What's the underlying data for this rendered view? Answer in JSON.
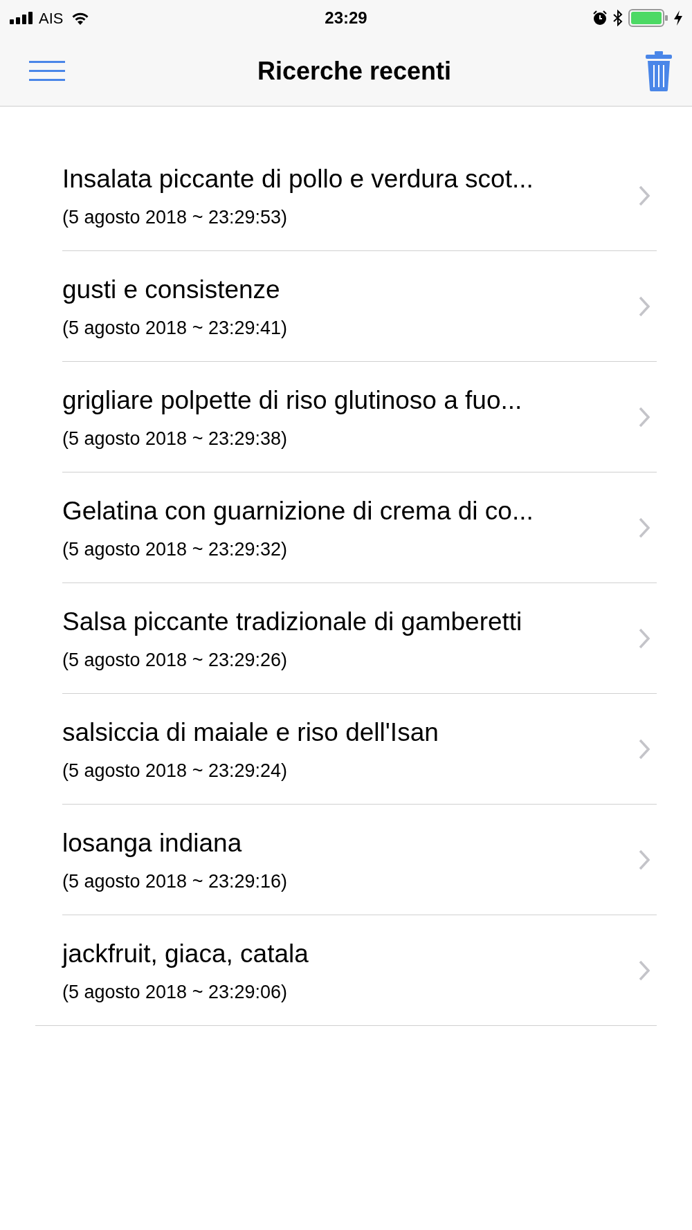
{
  "status_bar": {
    "carrier": "AIS",
    "time": "23:29"
  },
  "header": {
    "title": "Ricerche recenti"
  },
  "searches": [
    {
      "title": "Insalata piccante di pollo e verdura scot...",
      "timestamp": "(5 agosto 2018 ~ 23:29:53)"
    },
    {
      "title": "gusti e consistenze",
      "timestamp": "(5 agosto 2018 ~ 23:29:41)"
    },
    {
      "title": "grigliare polpette di riso glutinoso a fuo...",
      "timestamp": "(5 agosto 2018 ~ 23:29:38)"
    },
    {
      "title": "Gelatina con guarnizione di crema di co...",
      "timestamp": "(5 agosto 2018 ~ 23:29:32)"
    },
    {
      "title": "Salsa piccante tradizionale di gamberetti",
      "timestamp": "(5 agosto 2018 ~ 23:29:26)"
    },
    {
      "title": "salsiccia di maiale e riso dell'Isan",
      "timestamp": "(5 agosto 2018 ~ 23:29:24)"
    },
    {
      "title": "losanga indiana",
      "timestamp": "(5 agosto 2018 ~ 23:29:16)"
    },
    {
      "title": "jackfruit, giaca, catala",
      "timestamp": "(5 agosto 2018 ~ 23:29:06)"
    }
  ]
}
